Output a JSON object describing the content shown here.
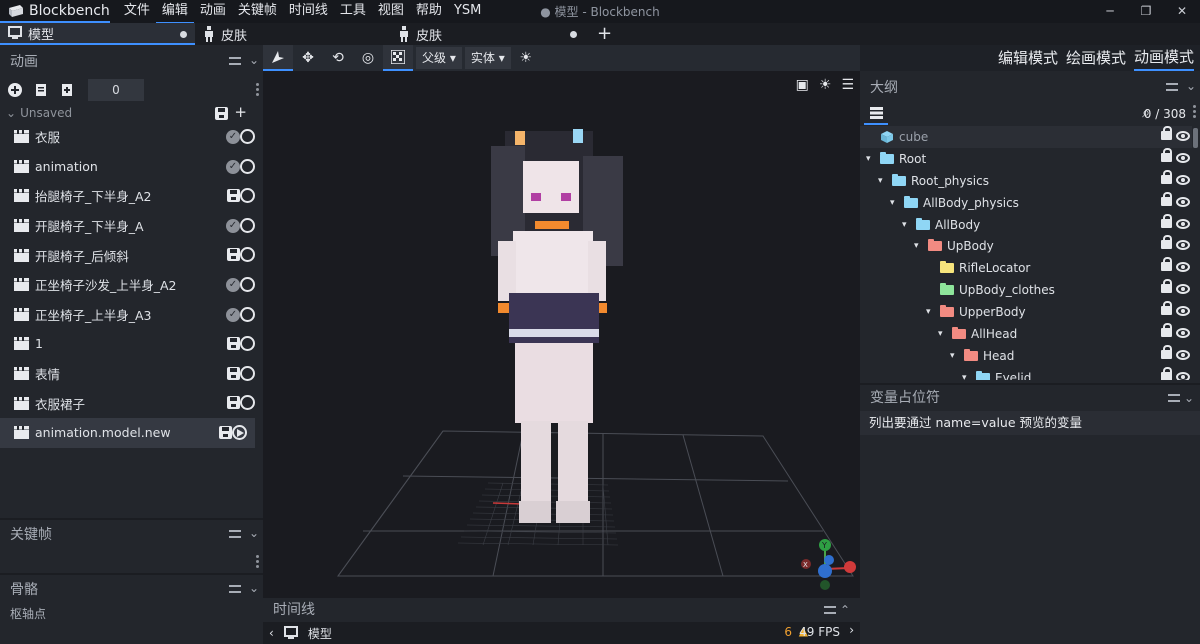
{
  "app": {
    "name": "Blockbench",
    "window_title": "● 模型 - Blockbench",
    "menu": [
      "文件",
      "编辑",
      "动画",
      "关键帧",
      "时间线",
      "工具",
      "视图",
      "帮助",
      "YSM"
    ]
  },
  "tabs": [
    {
      "label": "模型",
      "modified": true,
      "active": true
    },
    {
      "label": "皮肤",
      "modified": false,
      "active": false
    },
    {
      "label": "皮肤",
      "modified": true,
      "active": false
    }
  ],
  "left_panel": {
    "animations_title": "动画",
    "counter_value": "0",
    "group_label": "Unsaved",
    "animations": [
      {
        "name": "衣服",
        "status": "check"
      },
      {
        "name": "animation",
        "status": "check"
      },
      {
        "name": "抬腿椅子_下半身_A2",
        "status": "save"
      },
      {
        "name": "开腿椅子_下半身_A",
        "status": "check"
      },
      {
        "name": "开腿椅子_后倾斜",
        "status": "save"
      },
      {
        "name": "正坐椅子沙发_上半身_A2",
        "status": "check"
      },
      {
        "name": "正坐椅子_上半身_A3",
        "status": "check"
      },
      {
        "name": "1",
        "status": "save"
      },
      {
        "name": "表情",
        "status": "save"
      },
      {
        "name": "衣服裙子",
        "status": "save"
      },
      {
        "name": "animation.model.new",
        "status": "save",
        "selected": true,
        "playing": true
      }
    ],
    "keyframe_title": "关键帧",
    "bone_title": "骨骼",
    "pivot_label": "枢轴点"
  },
  "viewport_toolbar": {
    "parent_label": "父级",
    "solid_label": "实体"
  },
  "timeline": {
    "title": "时间线",
    "model_label": "模型",
    "warnings": "6",
    "fps": "49 FPS"
  },
  "modes": {
    "edit": "编辑模式",
    "paint": "绘画模式",
    "animate": "动画模式"
  },
  "outliner": {
    "title": "大纲",
    "count": "0 / 308",
    "rows": [
      {
        "name": "cube",
        "depth": 0,
        "type": "cube"
      },
      {
        "name": "Root",
        "depth": 0,
        "color": "#8fd6f5",
        "expanded": true
      },
      {
        "name": "Root_physics",
        "depth": 1,
        "color": "#8fd6f5",
        "expanded": true
      },
      {
        "name": "AllBody_physics",
        "depth": 2,
        "color": "#8fd6f5",
        "expanded": true
      },
      {
        "name": "AllBody",
        "depth": 3,
        "color": "#8fd6f5",
        "expanded": true
      },
      {
        "name": "UpBody",
        "depth": 4,
        "color": "#f28b82",
        "expanded": true
      },
      {
        "name": "RifleLocator",
        "depth": 5,
        "color": "#f6e47c",
        "expanded": false
      },
      {
        "name": "UpBody_clothes",
        "depth": 5,
        "color": "#8ee59b",
        "expanded": false
      },
      {
        "name": "UpperBody",
        "depth": 5,
        "color": "#f28b82",
        "expanded": true
      },
      {
        "name": "AllHead",
        "depth": 6,
        "color": "#f28b82",
        "expanded": true
      },
      {
        "name": "Head",
        "depth": 7,
        "color": "#f28b82",
        "expanded": true
      },
      {
        "name": "Eyelid",
        "depth": 8,
        "color": "#8fd6f5",
        "expanded": true
      }
    ]
  },
  "variables": {
    "title": "变量占位符",
    "description": "列出要通过 name=value 预览的变量"
  },
  "colors": {
    "accent": "#3e90ff",
    "panel": "#23262c",
    "viewport": "#1a1b20"
  }
}
